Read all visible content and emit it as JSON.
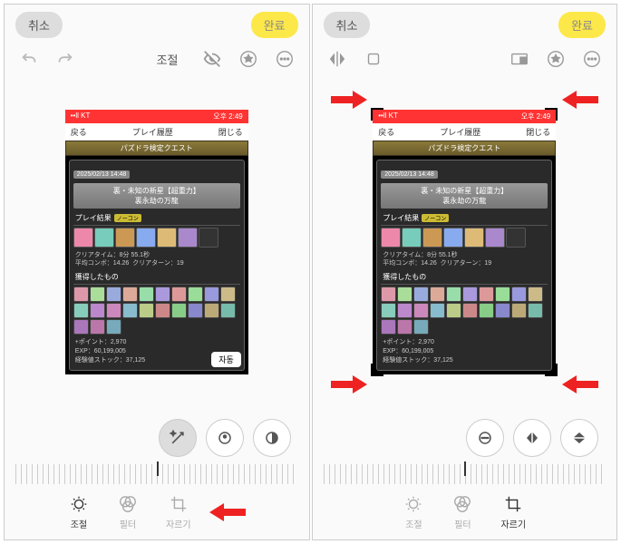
{
  "header": {
    "cancel": "취소",
    "done": "완료"
  },
  "toolbar": {
    "adjust": "조절"
  },
  "phone": {
    "status": {
      "carrier": "••ll KT",
      "wifi": "⬤",
      "time": "오후 2:49"
    },
    "nav": {
      "back": "戻る",
      "title": "プレイ履歴",
      "close": "閉じる"
    },
    "banner": "パズドラ検定クエスト",
    "date": "2025/02/13 14:48",
    "quest_title": "裏・未知の新星【超重力】",
    "quest_sub": "裏永劫の万龍",
    "result_h": "プレイ結果",
    "tag": "ノーコン",
    "stats": {
      "clear": "クリアタイム：8分 55.1秒",
      "combo": "平均コンボ：14.26",
      "turn": "クリアターン：19"
    },
    "drops_h": "獲得したもの",
    "rewards": {
      "points": "+ポイント：2,970",
      "exp": "EXP：60,199,005",
      "stock": "経験値ストック：37,125"
    },
    "auto": "자동"
  },
  "tabs": {
    "adjust": "조절",
    "filter": "필터",
    "crop": "자르기"
  },
  "icon_colors": [
    "#e8a",
    "#7cb",
    "#c95",
    "#8ae",
    "#db7",
    "#a8c",
    "#555"
  ]
}
